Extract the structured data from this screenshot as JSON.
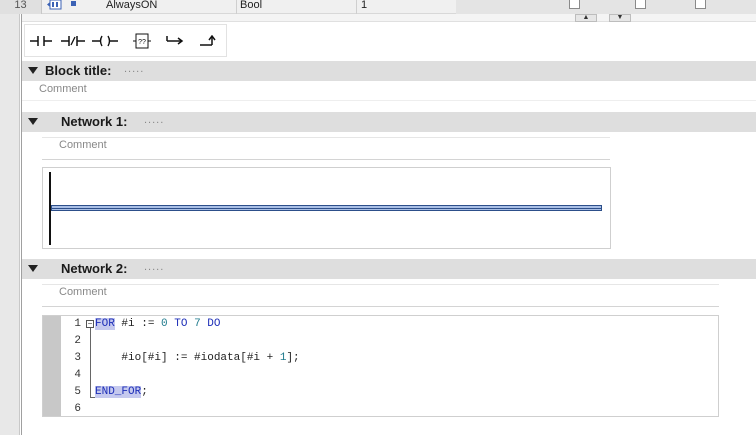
{
  "variable_row": {
    "row_number": "13",
    "name": "AlwaysON",
    "data_type": "Bool",
    "start_value": "1"
  },
  "toolbar": {
    "buttons": [
      {
        "icon": "normally-open-contact-icon"
      },
      {
        "icon": "normally-closed-contact-icon"
      },
      {
        "icon": "output-coil-icon"
      },
      {
        "icon": "empty-box-icon",
        "label": "??"
      },
      {
        "icon": "open-branch-icon"
      },
      {
        "icon": "close-branch-icon"
      }
    ]
  },
  "block": {
    "title_label": "Block title:",
    "title_value": ".....",
    "comment": "Comment"
  },
  "network1": {
    "label": "Network 1:",
    "title_value": ".....",
    "comment": "Comment"
  },
  "network2": {
    "label": "Network 2:",
    "title_value": ".....",
    "comment": "Comment",
    "code": {
      "line_numbers": [
        "1",
        "2",
        "3",
        "4",
        "5",
        "6"
      ],
      "line1": {
        "kw_for": "FOR",
        "rest1": " #i := ",
        "n0": "0",
        "sp1": " ",
        "kw_to": "TO",
        "sp2": " ",
        "n7": "7",
        "sp3": " ",
        "kw_do": "DO"
      },
      "line3": {
        "text1": "    #io[#i] := #iodata[#i + ",
        "n1": "1",
        "text2": "];"
      },
      "line5": {
        "kw_end": "END_FOR",
        "semi": ";"
      }
    }
  },
  "colors": {
    "section_header": "#dedede",
    "keyword": "#1e2fb8",
    "rung": "#2d4f8a"
  }
}
